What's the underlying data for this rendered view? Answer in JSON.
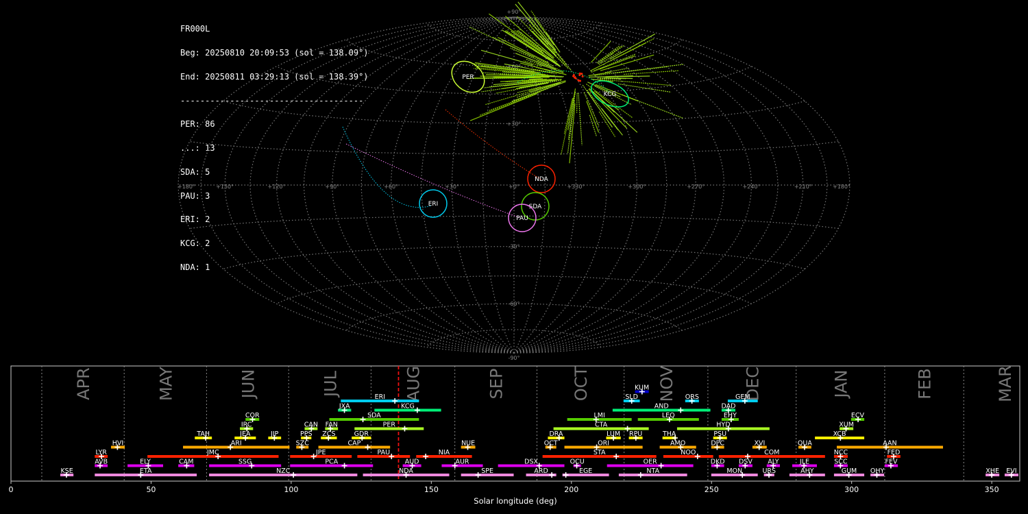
{
  "header": {
    "station": "FR000L",
    "begin": "Beg: 20250810 20:09:53 (sol = 138.09°)",
    "end": "End: 20250811 03:29:13 (sol = 138.39°)",
    "separator": "-------------------------------------",
    "counts": [
      "PER: 86",
      "...: 13",
      "SDA: 5",
      "PAU: 3",
      "ERI: 2",
      "KCG: 2",
      "NDA: 1"
    ]
  },
  "chart_data": [
    {
      "type": "scatter",
      "title": "Radiant sky map (Hammer projection)",
      "lon_labels": [
        "+180",
        "+150",
        "+120",
        "+90",
        "+60",
        "+30",
        "+0",
        "+330",
        "+300",
        "+270",
        "+240",
        "+210",
        "+180"
      ],
      "lat_labels": [
        "+90",
        "+60",
        "+30",
        "-30",
        "-60",
        "-90"
      ],
      "radiants": [
        {
          "code": "PER",
          "lon": 46,
          "lat": 53,
          "color": "#ccff33"
        },
        {
          "code": "KCG",
          "lon": 322,
          "lat": 42,
          "color": "#00ee77"
        },
        {
          "code": "NDA",
          "lon": 340,
          "lat": 2,
          "color": "#ff2200"
        },
        {
          "code": "SDA",
          "lon": 344,
          "lat": -9,
          "color": "#55cc00"
        },
        {
          "code": "PAU",
          "lon": 350,
          "lat": -14,
          "color": "#ee77ee"
        },
        {
          "code": "ERI",
          "lon": 52,
          "lat": -9,
          "color": "#00ccee"
        }
      ]
    },
    {
      "type": "bar",
      "xlabel": "Solar longitude (deg)",
      "xlim": [
        0,
        360
      ],
      "xticks": [
        0,
        50,
        100,
        150,
        200,
        250,
        300,
        350
      ],
      "current_sol": 138.3,
      "months": [
        {
          "label": "APR",
          "start": 11
        },
        {
          "label": "MAY",
          "start": 40.4
        },
        {
          "label": "JUN",
          "start": 69.8
        },
        {
          "label": "JUL",
          "start": 99.1
        },
        {
          "label": "AUG",
          "start": 128.5
        },
        {
          "label": "SEP",
          "start": 158.4
        },
        {
          "label": "OCT",
          "start": 187.7
        },
        {
          "label": "NOV",
          "start": 218.8
        },
        {
          "label": "DEC",
          "start": 248.7
        },
        {
          "label": "JAN",
          "start": 280.2
        },
        {
          "label": "FEB",
          "start": 311.8
        },
        {
          "label": "MAR",
          "start": 340
        }
      ],
      "rows": [
        {
          "color": "#ee88dd",
          "showers": [
            {
              "code": "KSE",
              "start": 17.6,
              "end": 22.3,
              "peak": 19.8
            },
            {
              "code": "ETA",
              "start": 29.9,
              "end": 66.3,
              "peak": 46.3
            },
            {
              "code": "NZC",
              "start": 70.7,
              "end": 123.6,
              "peak": 100.8
            },
            {
              "code": "NDA",
              "start": 125.6,
              "end": 156.4,
              "peak": 141
            },
            {
              "code": "SPE",
              "start": 160.6,
              "end": 179.4,
              "peak": 166.7
            },
            {
              "code": "ARD",
              "start": 183.8,
              "end": 194.6,
              "peak": 193
            },
            {
              "code": "EGE",
              "start": 196.8,
              "end": 213.4,
              "peak": 198
            },
            {
              "code": "NTA",
              "start": 216.9,
              "end": 241.3,
              "peak": 224.7
            },
            {
              "code": "MON",
              "start": 249.9,
              "end": 266.5,
              "peak": 261
            },
            {
              "code": "URS",
              "start": 268.7,
              "end": 272.4,
              "peak": 270.5
            },
            {
              "code": "AHY",
              "start": 277.8,
              "end": 290.5,
              "peak": 285
            },
            {
              "code": "GUM",
              "start": 293.7,
              "end": 304.5,
              "peak": 299
            },
            {
              "code": "OHY",
              "start": 306.7,
              "end": 311.6,
              "peak": 309
            },
            {
              "code": "XHE",
              "start": 347.8,
              "end": 352.7,
              "peak": 350
            },
            {
              "code": "EVI",
              "start": 354.6,
              "end": 359.5,
              "peak": 357
            }
          ]
        },
        {
          "color": "#dd00ee",
          "showers": [
            {
              "code": "AVB",
              "start": 29.9,
              "end": 34.5,
              "peak": 31.8
            },
            {
              "code": "ELY",
              "start": 41.6,
              "end": 54.3,
              "peak": 49
            },
            {
              "code": "CAM",
              "start": 59.7,
              "end": 65.4,
              "peak": 62.7
            },
            {
              "code": "SSG",
              "start": 70.7,
              "end": 96.4,
              "peak": 85.9
            },
            {
              "code": "PCA",
              "start": 99.6,
              "end": 129.2,
              "peak": 119
            },
            {
              "code": "AUD",
              "start": 139.8,
              "end": 146.4,
              "peak": 143.2
            },
            {
              "code": "AUR",
              "start": 153.7,
              "end": 168.4,
              "peak": 158.4
            },
            {
              "code": "DSX",
              "start": 173.8,
              "end": 197.5,
              "peak": 188.5
            },
            {
              "code": "OCU",
              "start": 200.7,
              "end": 203.4,
              "peak": 201.9
            },
            {
              "code": "OER",
              "start": 212.7,
              "end": 243.5,
              "peak": 232
            },
            {
              "code": "DKD",
              "start": 249.9,
              "end": 254.5,
              "peak": 252
            },
            {
              "code": "DSV",
              "start": 259.7,
              "end": 264.6,
              "peak": 262
            },
            {
              "code": "ALY",
              "start": 269.7,
              "end": 274.4,
              "peak": 272
            },
            {
              "code": "JLE",
              "start": 278.8,
              "end": 287.6,
              "peak": 283
            },
            {
              "code": "SCC",
              "start": 293.7,
              "end": 298.6,
              "peak": 296
            },
            {
              "code": "FEV",
              "start": 311.8,
              "end": 316.5,
              "peak": 314
            }
          ]
        },
        {
          "color": "#ff2200",
          "showers": [
            {
              "code": "LYR",
              "start": 29.9,
              "end": 34.5,
              "peak": 32.3
            },
            {
              "code": "JMC",
              "start": 48.7,
              "end": 95.5,
              "peak": 73.9
            },
            {
              "code": "JPE",
              "start": 99.6,
              "end": 121.6,
              "peak": 108
            },
            {
              "code": "PAU",
              "start": 123.6,
              "end": 142.4,
              "peak": 135.8
            },
            {
              "code": "NIA",
              "start": 144.6,
              "end": 164.5,
              "peak": 148
            },
            {
              "code": "STA",
              "start": 189.7,
              "end": 230.3,
              "peak": 216
            },
            {
              "code": "NOO",
              "start": 232.8,
              "end": 250.6,
              "peak": 245
            },
            {
              "code": "COM",
              "start": 252.6,
              "end": 290.5,
              "peak": 262.9
            },
            {
              "code": "NCC",
              "start": 293.7,
              "end": 298.6,
              "peak": 296
            },
            {
              "code": "FED",
              "start": 312.6,
              "end": 317.4,
              "peak": 315
            }
          ]
        },
        {
          "color": "#ffaa00",
          "showers": [
            {
              "code": "HVI",
              "start": 35.7,
              "end": 40.6,
              "peak": 38
            },
            {
              "code": "ARI",
              "start": 61.4,
              "end": 99.4,
              "peak": 78.3
            },
            {
              "code": "SZC",
              "start": 101.8,
              "end": 106.2,
              "peak": 103.8
            },
            {
              "code": "CAP",
              "start": 109.7,
              "end": 135.3,
              "peak": 127.3
            },
            {
              "code": "NUE",
              "start": 160.6,
              "end": 165.7,
              "peak": 163
            },
            {
              "code": "OCT",
              "start": 190.7,
              "end": 194.6,
              "peak": 192.4
            },
            {
              "code": "ORI",
              "start": 197.5,
              "end": 225.4,
              "peak": 209
            },
            {
              "code": "AMO",
              "start": 231.5,
              "end": 244.5,
              "peak": 239
            },
            {
              "code": "DPC",
              "start": 249.9,
              "end": 254.5,
              "peak": 252
            },
            {
              "code": "XVI",
              "start": 264.6,
              "end": 269.7,
              "peak": 267
            },
            {
              "code": "QUA",
              "start": 281,
              "end": 285.6,
              "peak": 283.2
            },
            {
              "code": "AAN",
              "start": 294.7,
              "end": 332.6,
              "peak": 312.3
            }
          ]
        },
        {
          "color": "#ffee00",
          "showers": [
            {
              "code": "TAH",
              "start": 65.6,
              "end": 71.7,
              "peak": 69.5
            },
            {
              "code": "JEA",
              "start": 79.8,
              "end": 87.4,
              "peak": 83.7
            },
            {
              "code": "JIP",
              "start": 91.8,
              "end": 96.4,
              "peak": 94
            },
            {
              "code": "PPS",
              "start": 103.5,
              "end": 107.2,
              "peak": 105.5
            },
            {
              "code": "ZCS",
              "start": 110.6,
              "end": 116.3,
              "peak": 113.3
            },
            {
              "code": "GDR",
              "start": 121.6,
              "end": 128.5,
              "peak": 125.3
            },
            {
              "code": "DRA",
              "start": 191.6,
              "end": 197.5,
              "peak": 195.6
            },
            {
              "code": "LUM",
              "start": 212.4,
              "end": 217.6,
              "peak": 215
            },
            {
              "code": "RPU",
              "start": 220.5,
              "end": 225.4,
              "peak": 223
            },
            {
              "code": "THA",
              "start": 232.5,
              "end": 237.4,
              "peak": 237
            },
            {
              "code": "PSU",
              "start": 250.6,
              "end": 255.5,
              "peak": 253
            },
            {
              "code": "XCB",
              "start": 286.9,
              "end": 304.5,
              "peak": 296
            }
          ]
        },
        {
          "color": "#aaff22",
          "showers": [
            {
              "code": "IRC",
              "start": 81.7,
              "end": 86.4,
              "peak": 84.2
            },
            {
              "code": "CAN",
              "start": 104.8,
              "end": 109.4,
              "peak": 107.2
            },
            {
              "code": "FAN",
              "start": 112.1,
              "end": 116.7,
              "peak": 114
            },
            {
              "code": "PER",
              "start": 122.6,
              "end": 147.3,
              "peak": 140.5
            },
            {
              "code": "CTA",
              "start": 193.6,
              "end": 227.6,
              "peak": 220
            },
            {
              "code": "HYD",
              "start": 237.7,
              "end": 270.7,
              "peak": 256
            },
            {
              "code": "XUM",
              "start": 295.7,
              "end": 300.6,
              "peak": 298
            }
          ]
        },
        {
          "color": "#55cc00",
          "showers": [
            {
              "code": "COR",
              "start": 83.7,
              "end": 88.6,
              "peak": 86.2
            },
            {
              "code": "SDA",
              "start": 113.6,
              "end": 145.6,
              "peak": 125.6
            },
            {
              "code": "LMI",
              "start": 198.5,
              "end": 221.5,
              "peak": 208.8
            },
            {
              "code": "LEQ",
              "start": 223.7,
              "end": 245.5,
              "peak": 235
            },
            {
              "code": "EHY",
              "start": 253.6,
              "end": 259.7,
              "peak": 257
            },
            {
              "code": "ECV",
              "start": 299.8,
              "end": 304.5,
              "peak": 302.3
            }
          ]
        },
        {
          "color": "#00ee77",
          "showers": [
            {
              "code": "JXA",
              "start": 116.7,
              "end": 121.4,
              "peak": 119
            },
            {
              "code": "KCG",
              "start": 129.7,
              "end": 153.5,
              "peak": 145
            },
            {
              "code": "AND",
              "start": 214.7,
              "end": 249.6,
              "peak": 239
            },
            {
              "code": "DAD",
              "start": 253.6,
              "end": 258.5,
              "peak": 256
            }
          ]
        },
        {
          "color": "#00ccee",
          "showers": [
            {
              "code": "ERI",
              "start": 117.7,
              "end": 145.6,
              "peak": 137
            },
            {
              "code": "SLD",
              "start": 218.6,
              "end": 224.4,
              "peak": 221.5
            },
            {
              "code": "ORS",
              "start": 240.6,
              "end": 245.5,
              "peak": 243
            },
            {
              "code": "GEM",
              "start": 255.8,
              "end": 266.5,
              "peak": 261.9
            }
          ]
        },
        {
          "color": "#0000cc",
          "showers": [
            {
              "code": "KUM",
              "start": 222.7,
              "end": 227.6,
              "peak": 225.2
            }
          ]
        }
      ]
    }
  ]
}
